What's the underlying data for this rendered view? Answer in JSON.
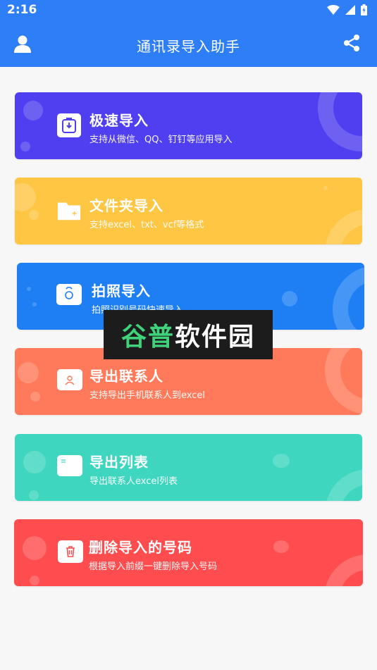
{
  "status_bar": {
    "time": "2:16"
  },
  "app_bar": {
    "title": "通讯录导入助手"
  },
  "cards": [
    {
      "title": "极速导入",
      "subtitle": "支持从微信、QQ、钉钉等应用导入",
      "color": "#4f3ff0",
      "icon": "clipboard-download-icon"
    },
    {
      "title": "文件夹导入",
      "subtitle": "支持excel、txt、vcf等格式",
      "color": "#ffc644",
      "icon": "folder-icon"
    },
    {
      "title": "拍照导入",
      "subtitle": "拍照识别号码快速导入",
      "color": "#1e7ff5",
      "icon": "camera-icon"
    },
    {
      "title": "导出联系人",
      "subtitle": "支持导出手机联系人到excel",
      "color": "#ff7a5a",
      "icon": "contact-card-icon"
    },
    {
      "title": "导出列表",
      "subtitle": "导出联系人excel列表",
      "color": "#3fd6c0",
      "icon": "list-window-icon"
    },
    {
      "title": "删除导入的号码",
      "subtitle": "根据导入前缀一键删除导入号码",
      "color": "#ff4d4f",
      "icon": "trash-icon"
    }
  ],
  "watermark": {
    "part1": "谷普",
    "part2": "软件园"
  }
}
